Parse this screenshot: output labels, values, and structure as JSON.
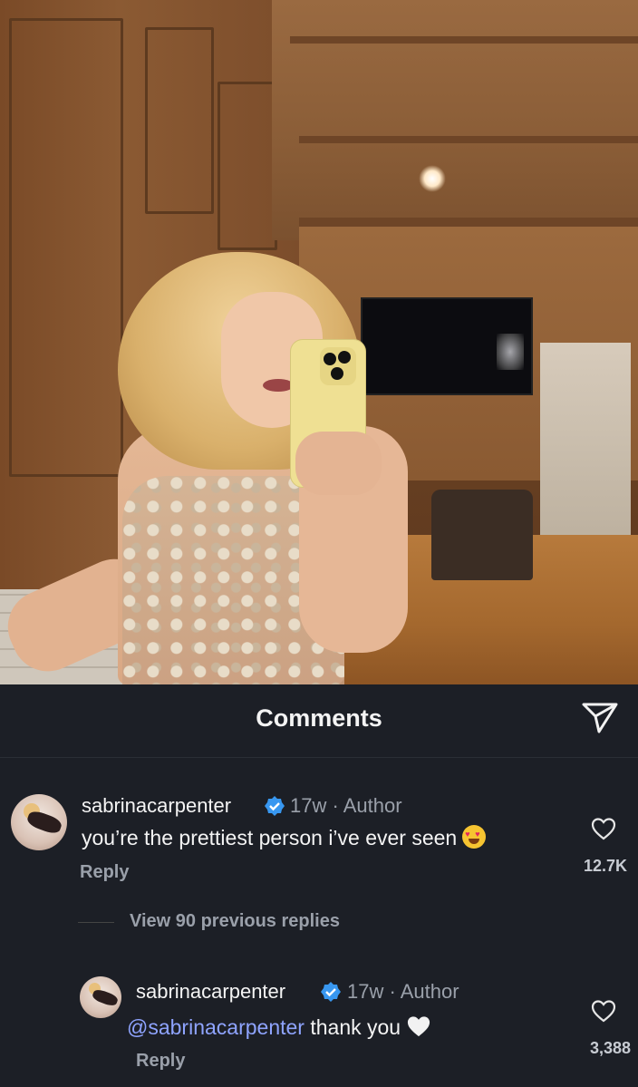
{
  "comments_sheet": {
    "title": "Comments"
  },
  "comments": [
    {
      "username": "sabrinacarpenter",
      "time": "17w",
      "role": "Author",
      "text": "you’re the prettiest person i’ve ever seen",
      "emoji": "heart-eyes-emoji",
      "reply_label": "Reply",
      "likes": "12.7K"
    }
  ],
  "view_replies": "View 90 previous replies",
  "reply": {
    "username": "sabrinacarpenter",
    "time": "17w",
    "role": "Author",
    "mention": "@sabrinacarpenter",
    "text": "thank you",
    "emoji": "white-heart-emoji",
    "reply_label": "Reply",
    "likes": "3,388"
  },
  "colors": {
    "background": "#1c1f26",
    "mention": "#8fa4ff",
    "verified": "#3897f0",
    "muted": "#9aa0aa"
  }
}
